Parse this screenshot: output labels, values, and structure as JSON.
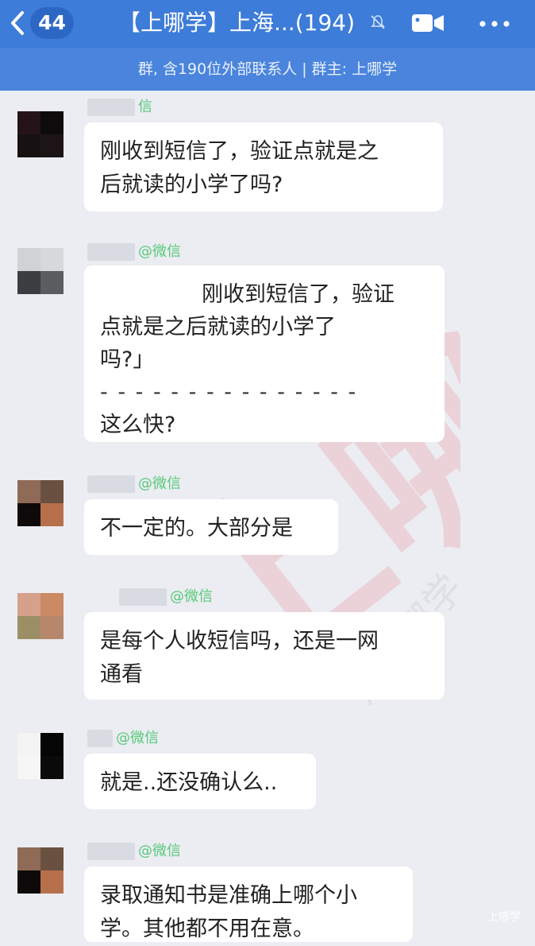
{
  "header": {
    "back_icon": "chevron-left-icon",
    "unread_count": "44",
    "title": "【上哪学】上海...(194)",
    "mute_icon": "bell-muted-icon",
    "video_icon": "video-call-icon",
    "more_icon": "more-dots-icon",
    "subtitle": "群, 含190位外部联系人 | 群主: 上哪学"
  },
  "messages": [
    {
      "sender_suffix": "信",
      "lines": [
        "刚收到短信了，验证点就是之",
        "后就读的小学了吗?"
      ]
    },
    {
      "sender_suffix": "@微信",
      "lines": [
        "刚收到短信了，验证",
        "点就是之后就读的小学了",
        "吗?」",
        "- - - - - - - - - - - - - - -",
        "这么快?"
      ]
    },
    {
      "sender_suffix": "@微信",
      "lines": [
        "不一定的。大部分是"
      ]
    },
    {
      "sender_suffix": "@微信",
      "lines": [
        "是每个人收短信吗，还是一网",
        "通看"
      ]
    },
    {
      "sender_suffix": "@微信",
      "lines": [
        "就是..还没确认么.."
      ]
    },
    {
      "sender_suffix": "@微信",
      "lines": [
        "录取通知书是准确上哪个小",
        "学。其他都不用在意。"
      ]
    }
  ],
  "watermark": {
    "text": "上哪学",
    "corner": "上哪学",
    "faint_text": "用上哪学"
  },
  "colors": {
    "topbar": "#3d7cd8",
    "subbar": "#4a84dc",
    "sender": "#58c97a",
    "background": "#ebedf2"
  }
}
